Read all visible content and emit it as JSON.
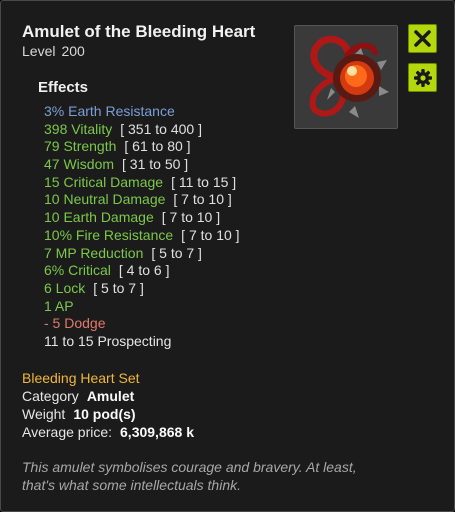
{
  "item": {
    "name": "Amulet of the Bleeding Heart",
    "level_label": "Level",
    "level_value": "200"
  },
  "effects_heading": "Effects",
  "effects": [
    {
      "text": "3% Earth Resistance",
      "range": "",
      "color": "#7b9fd6"
    },
    {
      "text": "398 Vitality",
      "range": "[ 351 to 400 ]",
      "color": "#7cc84a"
    },
    {
      "text": "79 Strength",
      "range": "[ 61 to 80 ]",
      "color": "#7cc84a"
    },
    {
      "text": "47 Wisdom",
      "range": "[ 31 to 50 ]",
      "color": "#7cc84a"
    },
    {
      "text": "15 Critical Damage",
      "range": "[ 11 to 15 ]",
      "color": "#7cc84a"
    },
    {
      "text": "10 Neutral Damage",
      "range": "[ 7 to 10 ]",
      "color": "#7cc84a"
    },
    {
      "text": "10 Earth Damage",
      "range": "[ 7 to 10 ]",
      "color": "#7cc84a"
    },
    {
      "text": "10% Fire Resistance",
      "range": "[ 7 to 10 ]",
      "color": "#7cc84a"
    },
    {
      "text": "7 MP Reduction",
      "range": "[ 5 to 7 ]",
      "color": "#7cc84a"
    },
    {
      "text": "6% Critical",
      "range": "[ 4 to 6 ]",
      "color": "#7cc84a"
    },
    {
      "text": "6 Lock",
      "range": "[ 5 to 7 ]",
      "color": "#7cc84a"
    },
    {
      "text": "1 AP",
      "range": "",
      "color": "#7cc84a"
    },
    {
      "text": "- 5 Dodge",
      "range": "",
      "color": "#e07a6a"
    },
    {
      "text": "11 to 15 Prospecting",
      "range": "",
      "color": "#e6e6e6"
    }
  ],
  "set_name": "Bleeding Heart Set",
  "properties": {
    "category_label": "Category",
    "category_value": "Amulet",
    "weight_label": "Weight",
    "weight_value": "10 pod(s)",
    "price_label": "Average price:",
    "price_value": "6,309,868 k"
  },
  "description": "This amulet symbolises courage and bravery. At least, that's what some intellectuals think.",
  "icons": {
    "close": "close-icon",
    "settings": "gear-icon",
    "item": "amulet-image"
  },
  "colors": {
    "button": "#b5d80c",
    "set": "#f0b73a",
    "bonus": "#7cc84a",
    "malus": "#e07a6a",
    "resistance": "#7b9fd6"
  }
}
